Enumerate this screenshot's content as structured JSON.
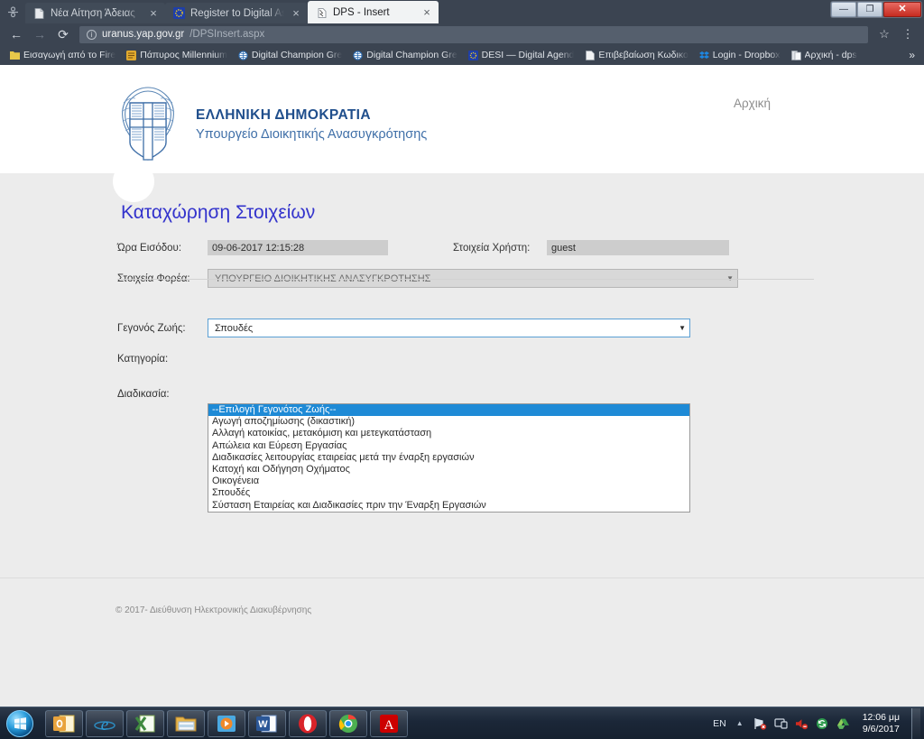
{
  "browser": {
    "tabs": [
      {
        "title": "Νέα Αίτηση Άδειας",
        "favicon": "document-icon",
        "close": "×",
        "active": false
      },
      {
        "title": "Register to Digital Assem",
        "favicon": "eu-circle-icon",
        "close": "×",
        "active": false
      },
      {
        "title": "DPS - Insert",
        "favicon": "broken-page-icon",
        "close": "×",
        "active": true
      }
    ],
    "nav": {
      "back": "←",
      "forward": "→",
      "reload": "⟳",
      "star_icon": "☆",
      "menu_icon": "⋮"
    },
    "address": {
      "info_icon": "i",
      "host": "uranus.yap.gov.gr",
      "path": "/DPSInsert.aspx"
    },
    "bookmarks": [
      {
        "label": "Εισαγωγή από το Fire",
        "icon": "folder-icon"
      },
      {
        "label": "Πάπυρος Millennium",
        "icon": "papyrus-icon"
      },
      {
        "label": "Digital Champion Gre",
        "icon": "globe-icon"
      },
      {
        "label": "Digital Champion Gre",
        "icon": "globe-icon"
      },
      {
        "label": "DESI — Digital Agend",
        "icon": "eu-circle-icon"
      },
      {
        "label": "Επιβεβαίωση Κωδικο",
        "icon": "document-icon"
      },
      {
        "label": "Login - Dropbox",
        "icon": "dropbox-icon"
      },
      {
        "label": "Αρχική - dps",
        "icon": "page-icon"
      }
    ],
    "bookmarks_overflow": "»",
    "window_controls": {
      "minimize": "—",
      "maximize": "❐",
      "close": "✕"
    }
  },
  "page": {
    "logo": {
      "line1": "ΕΛΛΗΝΙΚΗ ΔΗΜΟΚΡΑΤΙΑ",
      "line2": "Υπουργείο Διοικητικής Ανασυγκρότησης",
      "emblem_icon": "greek-coat-of-arms-icon"
    },
    "home_link": "Αρχική",
    "title": "Καταχώρηση Στοιχείων",
    "fields": {
      "entry_time_label": "Ώρα Εισόδου:",
      "entry_time_value": "09-06-2017 12:15:28",
      "user_label": "Στοιχεία Χρήστη:",
      "user_value": "guest",
      "org_label": "Στοιχεία Φορέα:",
      "org_value": "ΥΠΟΥΡΓΕΙΟ ΔΙΟΙΚΗΤΙΚΗΣ ΑΝΑΣΥΓΚΡΟΤΗΣΗΣ",
      "life_event_label": "Γεγονός Ζωής:",
      "life_event_value": "Σπουδές",
      "category_label": "Κατηγορία:",
      "procedure_label": "Διαδικασία:",
      "caret": "▼"
    },
    "dropdown_options": [
      "--Επιλογή Γεγονότος Ζωής--",
      "Αγωγή αποζημίωσης (δικαστική)",
      "Αλλαγή κατοικίας, μετακόμιση και μετεγκατάσταση",
      "Απώλεια και Εύρεση Εργασίας",
      "Διαδικασίες λειτουργίας εταιρείας μετά την έναρξη εργασιών",
      "Κατοχή και Οδήγηση Οχήματος",
      "Οικογένεια",
      "Σπουδές",
      "Σύσταση Εταιρείας και Διαδικασίες πριν την Έναρξη Εργασιών"
    ],
    "dropdown_highlight_index": 0,
    "footer": "© 2017- Διεύθυνση Ηλεκτρονικής Διακυβέρνησης"
  },
  "taskbar": {
    "start_icon": "windows-start-icon",
    "apps": [
      {
        "name": "outlook-icon",
        "glyph": "O"
      },
      {
        "name": "internet-explorer-icon",
        "glyph": "e"
      },
      {
        "name": "excel-icon",
        "glyph": "X"
      },
      {
        "name": "file-explorer-icon",
        "glyph": "▤"
      },
      {
        "name": "media-player-icon",
        "glyph": "▶"
      },
      {
        "name": "word-icon",
        "glyph": "W"
      },
      {
        "name": "opera-icon",
        "glyph": "O"
      },
      {
        "name": "chrome-icon",
        "glyph": "◎"
      },
      {
        "name": "acrobat-reader-icon",
        "glyph": "A"
      }
    ],
    "tray": {
      "language": "EN",
      "show_hidden_icon": "▲",
      "network_icon": "network-error-icon",
      "display_icon": "display-icon",
      "volume_icon": "volume-muted-icon",
      "sync_icon": "sync-icon",
      "drive_icon": "google-drive-icon"
    },
    "clock": {
      "time": "12:06 μμ",
      "date": "9/6/2017"
    }
  },
  "colors": {
    "accent_blue": "#1e8ad6",
    "title_blue": "#3333cc",
    "logo_blue": "#1f4e8c",
    "page_bg": "#ececec",
    "chrome_bg": "#3b4451"
  }
}
